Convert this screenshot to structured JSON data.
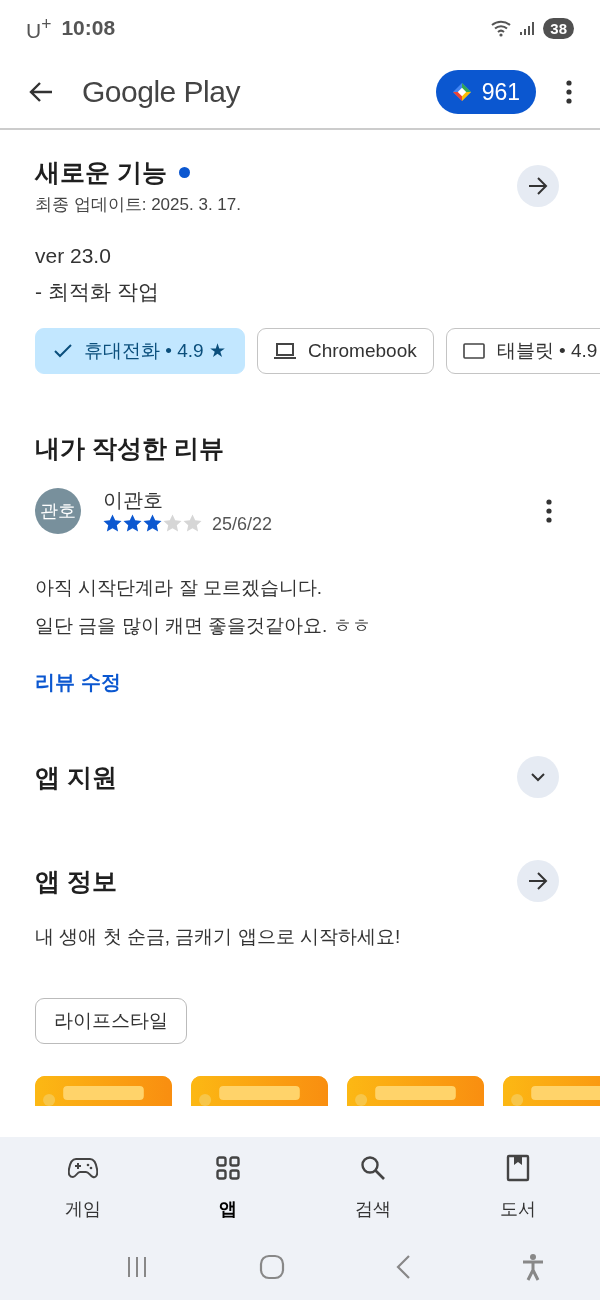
{
  "status_bar": {
    "carrier": "U$^{+}$",
    "time": "10:08",
    "battery": "38"
  },
  "app_bar": {
    "title": "Google Play",
    "points": "961"
  },
  "whats_new": {
    "title": "새로운 기능",
    "new_dot": true,
    "updated": "최종 업데이트: 2025. 3. 17.",
    "notes": [
      "ver 23.0",
      "- 최적화 작업"
    ]
  },
  "device_chips": [
    {
      "label": "휴대전화 • 4.9 ★",
      "selected": true
    },
    {
      "label": "Chromebook",
      "kind": "laptop",
      "selected": false
    },
    {
      "label": "태블릿 • 4.9",
      "kind": "tablet",
      "selected": false
    }
  ],
  "my_review": {
    "title": "내가 작성한 리뷰",
    "avatar": "관호",
    "name": "이관호",
    "stars": 3,
    "date": "25/6/22",
    "text": [
      "아직 시작단계라 잘 모르겠습니다.",
      "일단 금을 많이 캐면 좋을것같아요. ㅎㅎ"
    ],
    "edit_link": "리뷰 수정"
  },
  "sections": [
    {
      "title": "앱 지원",
      "kind": "expand",
      "expanded": false
    },
    {
      "title": "앱 정보",
      "kind": "link",
      "description": "내 생애 첫 순금, 금캐기 앱으로 시작하세요!"
    }
  ],
  "tags": [
    "라이프스타일"
  ],
  "bottom_nav": [
    {
      "label": "게임",
      "kind": "games",
      "selected": false
    },
    {
      "label": "앱",
      "kind": "apps",
      "selected": true
    },
    {
      "label": "검색",
      "kind": "search",
      "selected": false
    },
    {
      "label": "도서",
      "kind": "books",
      "selected": false
    }
  ]
}
